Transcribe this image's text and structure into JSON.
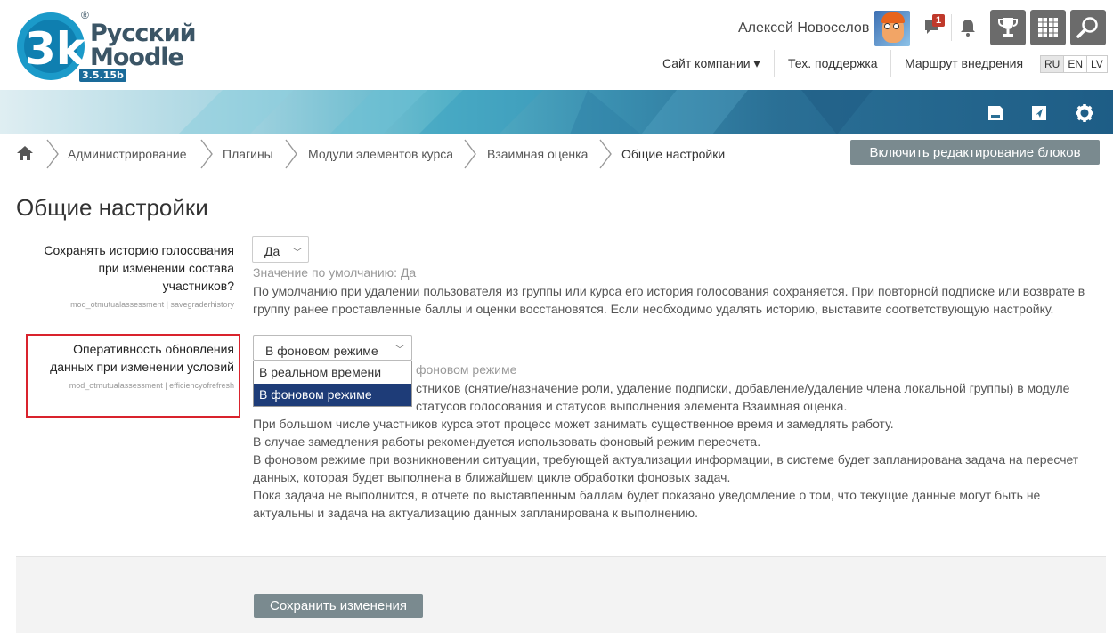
{
  "logo": {
    "text_line1": "Русский",
    "text_line2": "Moodle",
    "version": "3.5.15b",
    "registered": "®"
  },
  "header": {
    "user_name": "Алексей Новоселов",
    "chat_badge": "1",
    "nav": {
      "company_site": "Сайт компании ▾",
      "support": "Тех. поддержка",
      "route": "Маршрут внедрения"
    },
    "languages": [
      "RU",
      "EN",
      "LV"
    ],
    "active_language": "RU"
  },
  "breadcrumb": [
    "Администрирование",
    "Плагины",
    "Модули элементов курса",
    "Взаимная оценка",
    "Общие настройки"
  ],
  "edit_blocks_button": "Включить редактирование блоков",
  "page_title": "Общие настройки",
  "settings": [
    {
      "label_lines": [
        "Сохранять историю голосования",
        "при изменении состава",
        "участников?"
      ],
      "key": "mod_otmutualassessment | savegraderhistory",
      "value": "Да",
      "default": "Значение по умолчанию: Да",
      "desc": [
        "По умолчанию при удалении пользователя из группы или курса его история голосования сохраняется. При повторной подписке или возврате в",
        "группу ранее проставленные баллы и оценки восстановятся. Если необходимо удалять историю, выставите соответствующую настройку."
      ]
    },
    {
      "label_lines": [
        "Оперативность обновления",
        "данных при изменении условий"
      ],
      "key": "mod_otmutualassessment | efficiencyofrefresh",
      "value": "В фоновом режиме",
      "options": [
        "В реальном времени",
        "В фоновом режиме"
      ],
      "default_visible": "фоновом режиме",
      "desc": [
        "стников (снятие/назначение роли, удаление подписки, добавление/удаление члена локальной группы) в модуле",
        "статусов голосования и статусов выполнения элемента Взаимная оценка.",
        "При большом числе участников курса этот процесс может занимать существенное время и замедлять работу.",
        "В случае замедления работы рекомендуется использовать фоновый режим пересчета.",
        "В фоновом режиме при возникновении ситуации, требующей актуализации информации, в системе будет запланирована задача на пересчет",
        "данных, которая будет выполнена в ближайшем цикле обработки фоновых задач.",
        "Пока задача не выполнится, в отчете по выставленным баллам будет показано уведомление о том, что текущие данные могут быть не",
        "актуальны и задача на актуализацию данных запланирована к выполнению."
      ]
    }
  ],
  "save_button": "Сохранить изменения",
  "colors": {
    "accent_dark": "#1e3c78",
    "button_grey": "#7a8a8f",
    "highlight_red": "#d9232d"
  }
}
